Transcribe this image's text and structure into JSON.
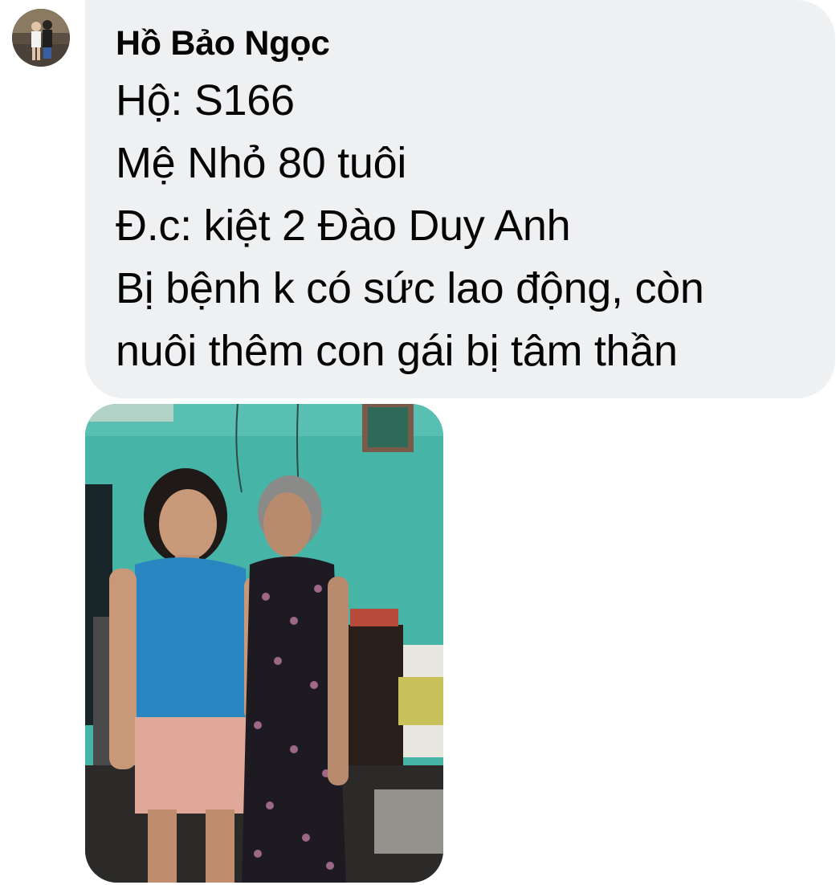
{
  "message": {
    "sender_name": "Hồ Bảo Ngọc",
    "lines": [
      "Hộ: S166",
      "Mệ Nhỏ 80 tuôi",
      "Đ.c: kiệt 2 Đào Duy Anh",
      "Bị bệnh k có sức lao động, còn",
      "nuôi thêm con gái bị tâm thần"
    ]
  },
  "colors": {
    "bubble_bg": "#eff0f2",
    "text": "#050505",
    "wall": "#3fb3a6"
  }
}
